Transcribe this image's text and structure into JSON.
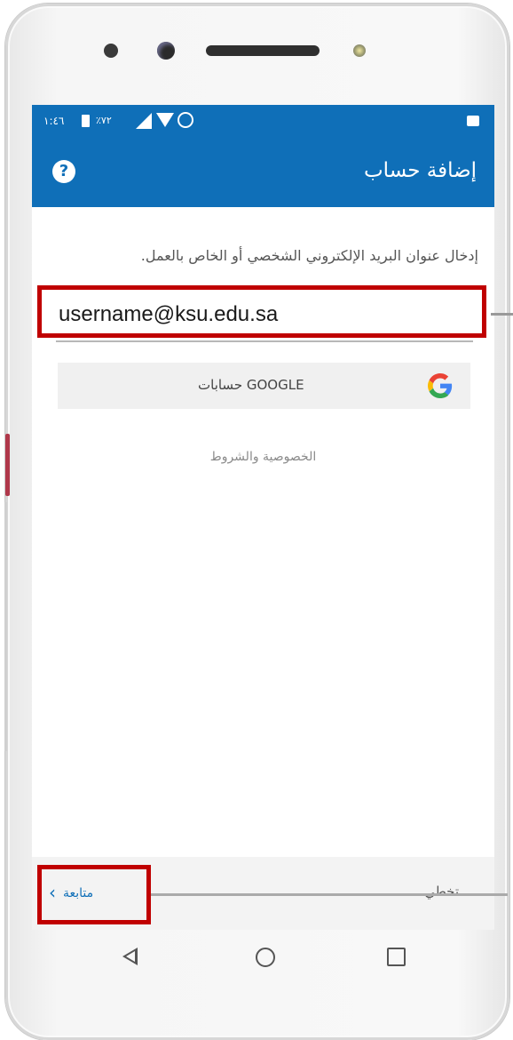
{
  "status_bar": {
    "time": "١:٤٦",
    "battery_text": "٪٧٢",
    "icons": [
      "battery-icon",
      "signal-icon",
      "wifi-icon",
      "alarm-icon",
      "photo-icon"
    ]
  },
  "app_bar": {
    "title": "إضافة حساب",
    "help_icon": "?"
  },
  "form": {
    "instruction": "إدخال عنوان البريد الإلكتروني الشخصي أو الخاص بالعمل.",
    "email_value": "username@ksu.edu.sa",
    "google_button_label": "حسابات GOOGLE",
    "privacy_link": "الخصوصية والشروط"
  },
  "bottom_bar": {
    "continue_label": "متابعة",
    "continue_chevron": "‹",
    "skip_label": "تخطي"
  },
  "colors": {
    "primary": "#0f6fb8",
    "highlight": "#c00000",
    "bottom_bar": "#f3f3f3"
  }
}
